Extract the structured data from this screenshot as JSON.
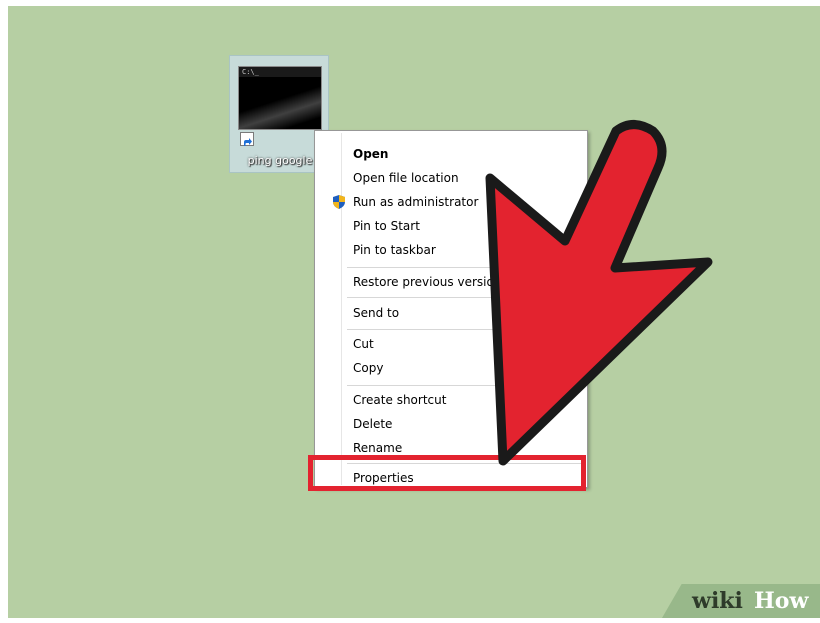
{
  "desktop": {
    "background": "#b6cfa3",
    "shortcut": {
      "label": "ping google",
      "icon": "cmd-window-icon",
      "badge_icon": "shortcut-arrow-icon"
    }
  },
  "context_menu": {
    "items": [
      {
        "label": "Open",
        "bold": true
      },
      {
        "label": "Open file location"
      },
      {
        "label": "Run as administrator",
        "icon": "uac-shield-icon"
      },
      {
        "label": "Pin to Start"
      },
      {
        "label": "Pin to taskbar"
      },
      {
        "label": "Restore previous versions"
      },
      {
        "label": "Send to"
      },
      {
        "label": "Cut"
      },
      {
        "label": "Copy"
      },
      {
        "label": "Create shortcut"
      },
      {
        "label": "Delete"
      },
      {
        "label": "Rename"
      },
      {
        "label": "Properties",
        "highlighted": true
      }
    ]
  },
  "annotation": {
    "arrow_color": "#e3232f",
    "highlight_color": "#e3232f",
    "target": "Properties"
  },
  "watermark": {
    "wiki": "wiki",
    "how": "How"
  }
}
